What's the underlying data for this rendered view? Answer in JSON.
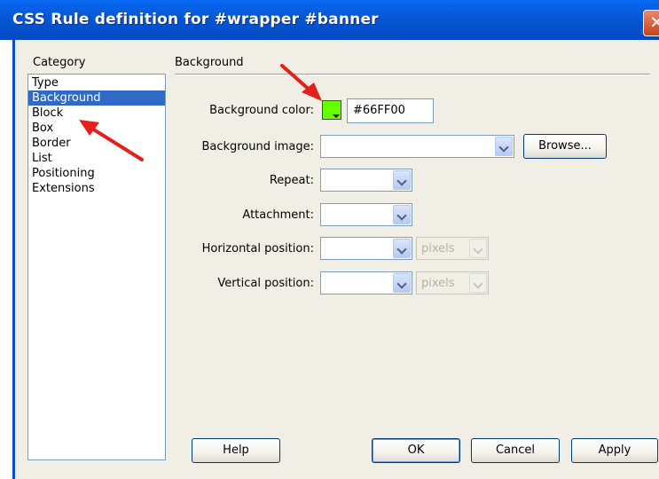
{
  "window": {
    "title": "CSS Rule definition for #wrapper #banner",
    "close_glyph": "✕"
  },
  "category": {
    "heading": "Category",
    "items": [
      "Type",
      "Background",
      "Block",
      "Box",
      "Border",
      "List",
      "Positioning",
      "Extensions"
    ],
    "selected": "Background"
  },
  "panel": {
    "heading": "Background",
    "background_color": {
      "label": "Background color:",
      "value": "#66FF00",
      "swatch_color": "#66FF00"
    },
    "background_image": {
      "label": "Background image:",
      "value": "",
      "browse_label": "Browse..."
    },
    "repeat": {
      "label": "Repeat:",
      "value": ""
    },
    "attachment": {
      "label": "Attachment:",
      "value": ""
    },
    "horizontal_position": {
      "label": "Horizontal position:",
      "value": "",
      "unit": "pixels"
    },
    "vertical_position": {
      "label": "Vertical position:",
      "value": "",
      "unit": "pixels"
    }
  },
  "buttons": {
    "help": "Help",
    "ok": "OK",
    "cancel": "Cancel",
    "apply": "Apply"
  },
  "annotations": {
    "arrow_color": "#e5201a"
  }
}
